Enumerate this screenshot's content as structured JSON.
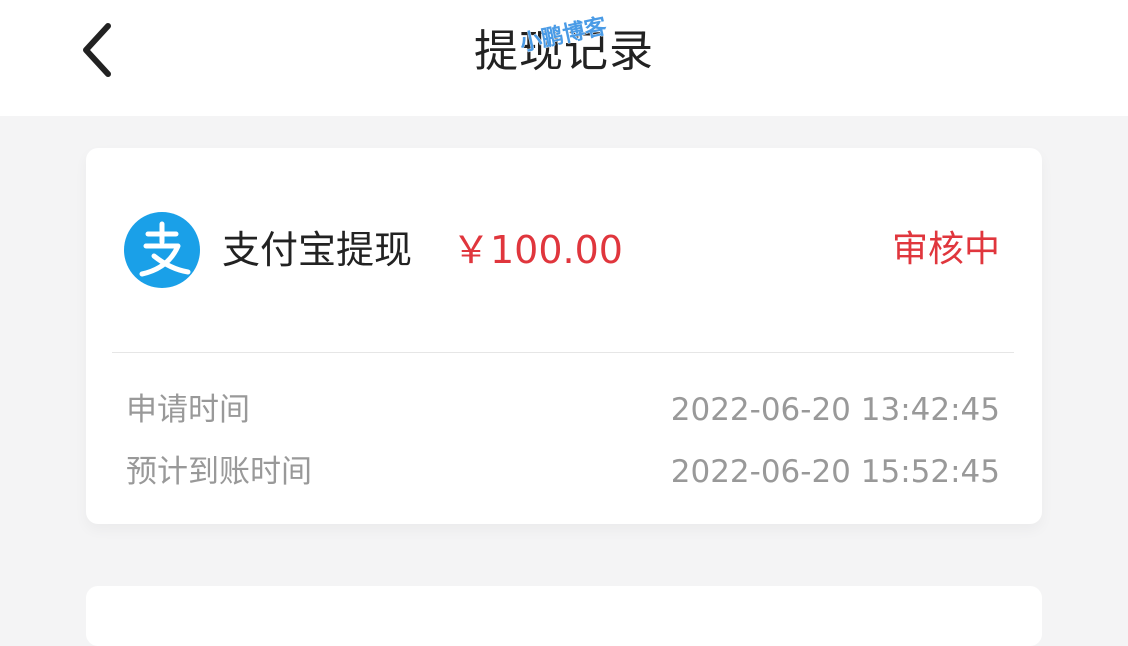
{
  "header": {
    "title": "提现记录",
    "back_icon": "chevron-left-icon",
    "watermark_text": "小鹏博客"
  },
  "records": [
    {
      "method": "支付宝提现",
      "method_icon": "alipay-icon",
      "amount": "￥100.00",
      "status": "审核中",
      "rows": [
        {
          "label": "申请时间",
          "value": "2022-06-20 13:42:45"
        },
        {
          "label": "预计到账时间",
          "value": "2022-06-20 15:52:45"
        }
      ]
    }
  ],
  "colors": {
    "accent_red": "#e0363d",
    "alipay_blue": "#1aa0e8",
    "background": "#f4f4f5",
    "muted_text": "#999999"
  }
}
